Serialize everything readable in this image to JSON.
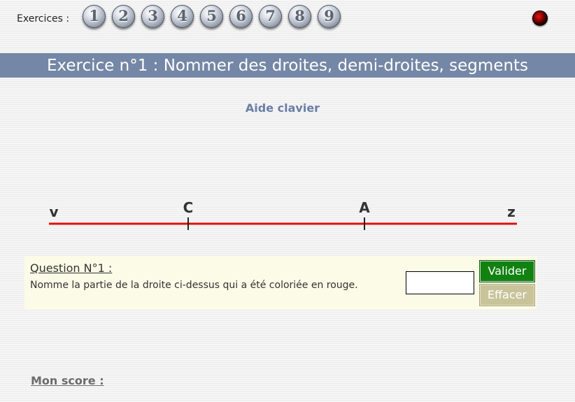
{
  "toolbar": {
    "exercises_label": "Exercices :",
    "exercise_buttons": [
      "1",
      "2",
      "3",
      "4",
      "5",
      "6",
      "7",
      "8",
      "9"
    ]
  },
  "title": "Exercice n°1 : Nommer des droites, demi-droites, segments",
  "aide_clavier": "Aide clavier",
  "figure": {
    "points": [
      {
        "label": "v",
        "ticked": false
      },
      {
        "label": "C",
        "ticked": true
      },
      {
        "label": "A",
        "ticked": true
      },
      {
        "label": "z",
        "ticked": false
      }
    ],
    "line_color": "#dd1111"
  },
  "question": {
    "title": "Question N°1 :",
    "text": "Nomme la partie de la droite ci-dessus qui a été coloriée en rouge.",
    "answer_value": "",
    "valider_label": "Valider",
    "effacer_label": "Effacer"
  },
  "score_label": "Mon score :",
  "colors": {
    "title_bar": "#7587a6",
    "aide": "#6a7ea8",
    "valider": "#118211",
    "effacer": "#c9c39a",
    "question_bg": "#fbfbe7"
  }
}
